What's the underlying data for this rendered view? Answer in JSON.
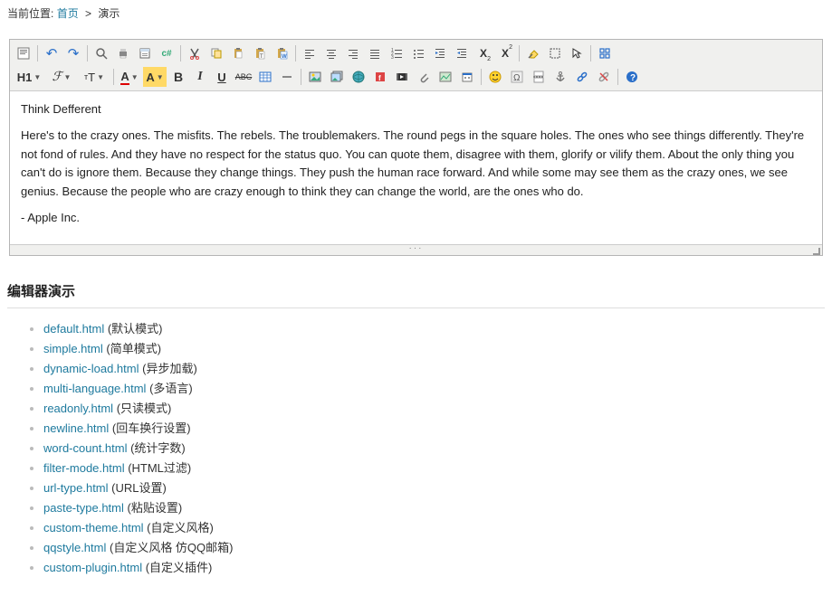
{
  "breadcrumb": {
    "label": "当前位置:",
    "home": "首页",
    "sep": ">",
    "current": "演示"
  },
  "toolbar": {
    "row1": {
      "source": "ℹ",
      "undo": "↶",
      "redo": "↷",
      "preview": "🔍",
      "print": "🖨",
      "template": "📄",
      "code": "c#",
      "cut": "✂",
      "copy": "📋",
      "paste": "📋",
      "pastetext": "📋",
      "pasteword": "W",
      "jl": "≡",
      "jc": "≡",
      "jr": "≡",
      "jf": "≡",
      "ol": "≡",
      "ul": "≡",
      "indent": "⇥",
      "outdent": "⇤",
      "sub": "X",
      "sub2": "2",
      "supx": "X",
      "sup2": "2",
      "clear": "🧹",
      "select": "▭",
      "pointer": "↖",
      "fullscreen": "⛶"
    },
    "row2": {
      "h": "H1",
      "font": "ℱ",
      "size": "τT",
      "forecolor": "A",
      "hilite": "A",
      "bold": "B",
      "italic": "I",
      "underline": "U",
      "strike": "ABC",
      "table": "⊞",
      "hr": "─",
      "img": "🖼",
      "multi": "🖼",
      "remote": "🌐",
      "flash": "▶",
      "media": "🎬",
      "file": "📎",
      "map": "🗺",
      "date": "📅",
      "emoji": "☺",
      "spec": "Ω",
      "page": "—",
      "anchor": "⚓",
      "link": "🔗",
      "unlink": "⛓",
      "about": "?"
    }
  },
  "editor": {
    "title": "Think Defferent",
    "body": "Here's to the crazy ones. The misfits. The rebels. The troublemakers. The round pegs in the square holes. The ones who see things differently. They're not fond of rules. And they have no respect for the status quo. You can quote them, disagree with them, glorify or vilify them. About the only thing you can't do is ignore them. Because they change things. They push the human race forward. And while some may see them as the crazy ones, we see genius. Because the people who are crazy enough to think they can change the world, are the ones who do.",
    "sign": "- Apple Inc."
  },
  "section_title": "编辑器演示",
  "links": [
    {
      "href": "default.html",
      "desc": "(默认模式)"
    },
    {
      "href": "simple.html",
      "desc": "(简单模式)"
    },
    {
      "href": "dynamic-load.html",
      "desc": "(异步加载)"
    },
    {
      "href": "multi-language.html",
      "desc": "(多语言)"
    },
    {
      "href": "readonly.html",
      "desc": "(只读模式)"
    },
    {
      "href": "newline.html",
      "desc": "(回车换行设置)"
    },
    {
      "href": "word-count.html",
      "desc": "(统计字数)"
    },
    {
      "href": "filter-mode.html",
      "desc": "(HTML过滤)"
    },
    {
      "href": "url-type.html",
      "desc": "(URL设置)"
    },
    {
      "href": "paste-type.html",
      "desc": "(粘贴设置)"
    },
    {
      "href": "custom-theme.html",
      "desc": "(自定义风格)"
    },
    {
      "href": "qqstyle.html",
      "desc": "(自定义风格 仿QQ邮箱)"
    },
    {
      "href": "custom-plugin.html",
      "desc": "(自定义插件)"
    }
  ]
}
